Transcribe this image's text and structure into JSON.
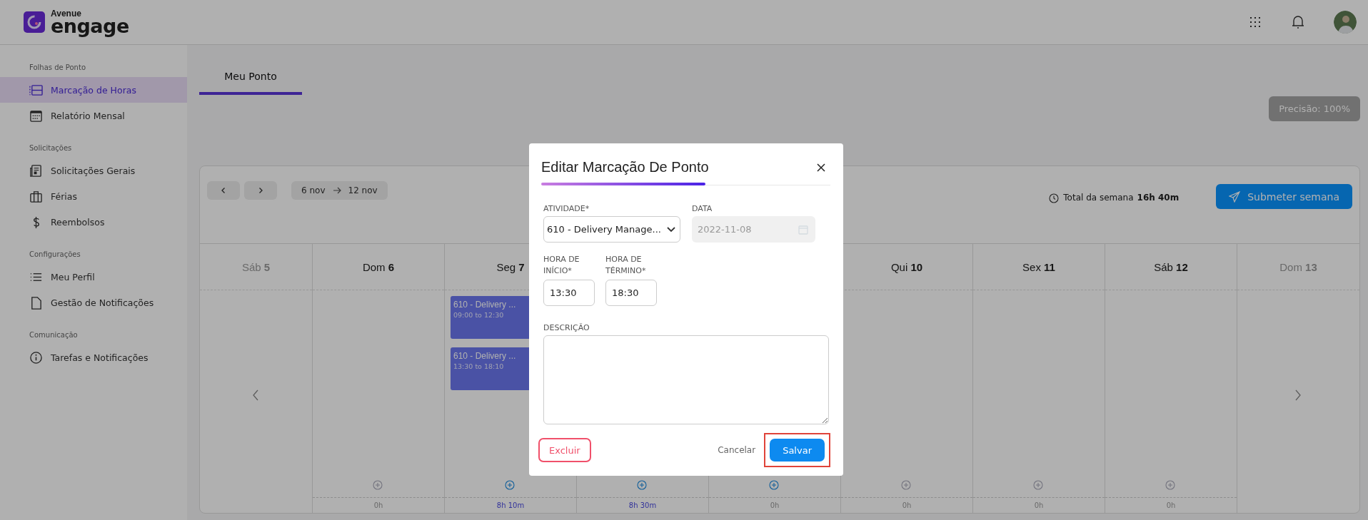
{
  "brand": {
    "small": "Avenue",
    "name": "engage"
  },
  "sidebar": {
    "sections": [
      {
        "title": "Folhas de Ponto",
        "items": [
          {
            "label": "Marcação de Horas",
            "selected": true
          },
          {
            "label": "Relatório Mensal",
            "selected": false
          }
        ]
      },
      {
        "title": "Solicitações",
        "items": [
          {
            "label": "Solicitações Gerais",
            "selected": false
          },
          {
            "label": "Férias",
            "selected": false
          },
          {
            "label": "Reembolsos",
            "selected": false
          }
        ]
      },
      {
        "title": "Configurações",
        "items": [
          {
            "label": "Meu Perfil",
            "selected": false
          },
          {
            "label": "Gestão de Notificações",
            "selected": false
          }
        ]
      },
      {
        "title": "Comunicação",
        "items": [
          {
            "label": "Tarefas e Notificações",
            "selected": false
          }
        ]
      }
    ]
  },
  "tabs": [
    {
      "label": "Meu Ponto",
      "selected": true
    }
  ],
  "precision_button": "Precisão: 100%",
  "week": {
    "start": "6 nov",
    "end": "12 nov",
    "total_label": "Total da semana",
    "total": "16h 40m",
    "submit": "Submeter semana"
  },
  "days": [
    {
      "kind": "prev-edge",
      "weekday": "Sáb",
      "day": "5"
    },
    {
      "kind": "day",
      "weekday": "Dom",
      "day": "6",
      "add_enabled": false,
      "total": "0h",
      "has_hours": false
    },
    {
      "kind": "day",
      "weekday": "Seg",
      "day": "7",
      "add_enabled": true,
      "total": "8h 10m",
      "has_hours": true,
      "events": [
        {
          "title": "610 - Delivery ...",
          "time": "09:00 to 12:30"
        },
        {
          "title": "610 - Delivery ...",
          "time": "13:30 to 18:10"
        }
      ]
    },
    {
      "kind": "day",
      "add_enabled": true,
      "total": "8h 30m",
      "has_hours": true
    },
    {
      "kind": "day",
      "add_enabled": true,
      "total": "0h",
      "has_hours": false
    },
    {
      "kind": "day",
      "weekday": "Qui",
      "day": "10",
      "add_enabled": false,
      "total": "0h",
      "has_hours": false
    },
    {
      "kind": "day",
      "weekday": "Sex",
      "day": "11",
      "add_enabled": false,
      "total": "0h",
      "has_hours": false
    },
    {
      "kind": "day",
      "weekday": "Sáb",
      "day": "12",
      "add_enabled": false,
      "total": "0h",
      "has_hours": false
    },
    {
      "kind": "next-edge",
      "weekday": "Dom",
      "day": "13"
    }
  ],
  "dialog": {
    "title": "Editar Marcação De Ponto",
    "activity": {
      "label": "ATIVIDADE*",
      "value": "610 - Delivery Manage..."
    },
    "date": {
      "label": "DATA",
      "value": "2022-11-08",
      "disabled": true
    },
    "start": {
      "label": "HORA DE INÍCIO*",
      "value": "13:30"
    },
    "end": {
      "label": "HORA DE TÉRMINO*",
      "value": "18:30"
    },
    "description": {
      "label": "DESCRIÇÃO"
    },
    "delete_button": "Excluir",
    "cancel_button": "Cancelar",
    "save_button": {
      "label": "Salvar",
      "highlighted": true
    }
  }
}
